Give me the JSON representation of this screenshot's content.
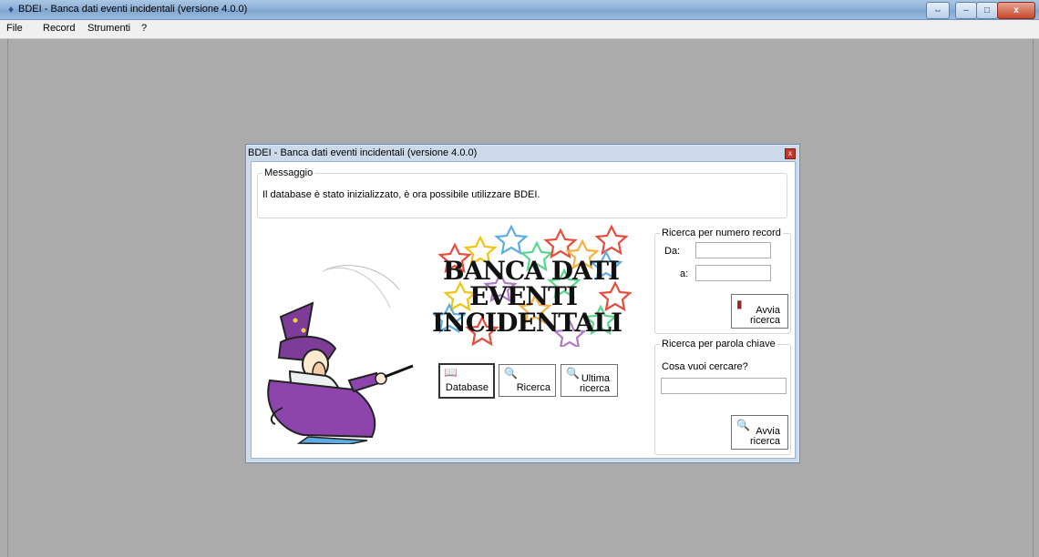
{
  "window": {
    "title": "BDEI - Banca dati eventi incidentali (versione 4.0.0)",
    "buttons": [
      "⇔",
      "–",
      "□",
      "x"
    ]
  },
  "menu": [
    "File",
    "Record",
    "Strumenti",
    "?"
  ],
  "dialog": {
    "title": "BDEI - Banca dati eventi incidentali (versione 4.0.0)",
    "message": {
      "legend": "Messaggio",
      "text": "Il database è stato inizializzato, è ora possibile utilizzare BDEI."
    },
    "banner": [
      "BANCA DATI",
      "EVENTI",
      "INCIDENTALI"
    ],
    "buttons": {
      "database": "Database",
      "ricerca": "Ricerca",
      "ultima": [
        "Ultima",
        "ricerca"
      ]
    },
    "record_search": {
      "legend": "Ricerca per numero record",
      "from_label": "Da:",
      "to_label": "a:",
      "from_value": "",
      "to_value": "",
      "button": [
        "Avvia",
        "ricerca"
      ]
    },
    "keyword_search": {
      "legend": "Ricerca per parola chiave",
      "prompt": "Cosa vuoi cercare?",
      "value": "",
      "button": [
        "Avvia",
        "ricerca"
      ]
    }
  }
}
